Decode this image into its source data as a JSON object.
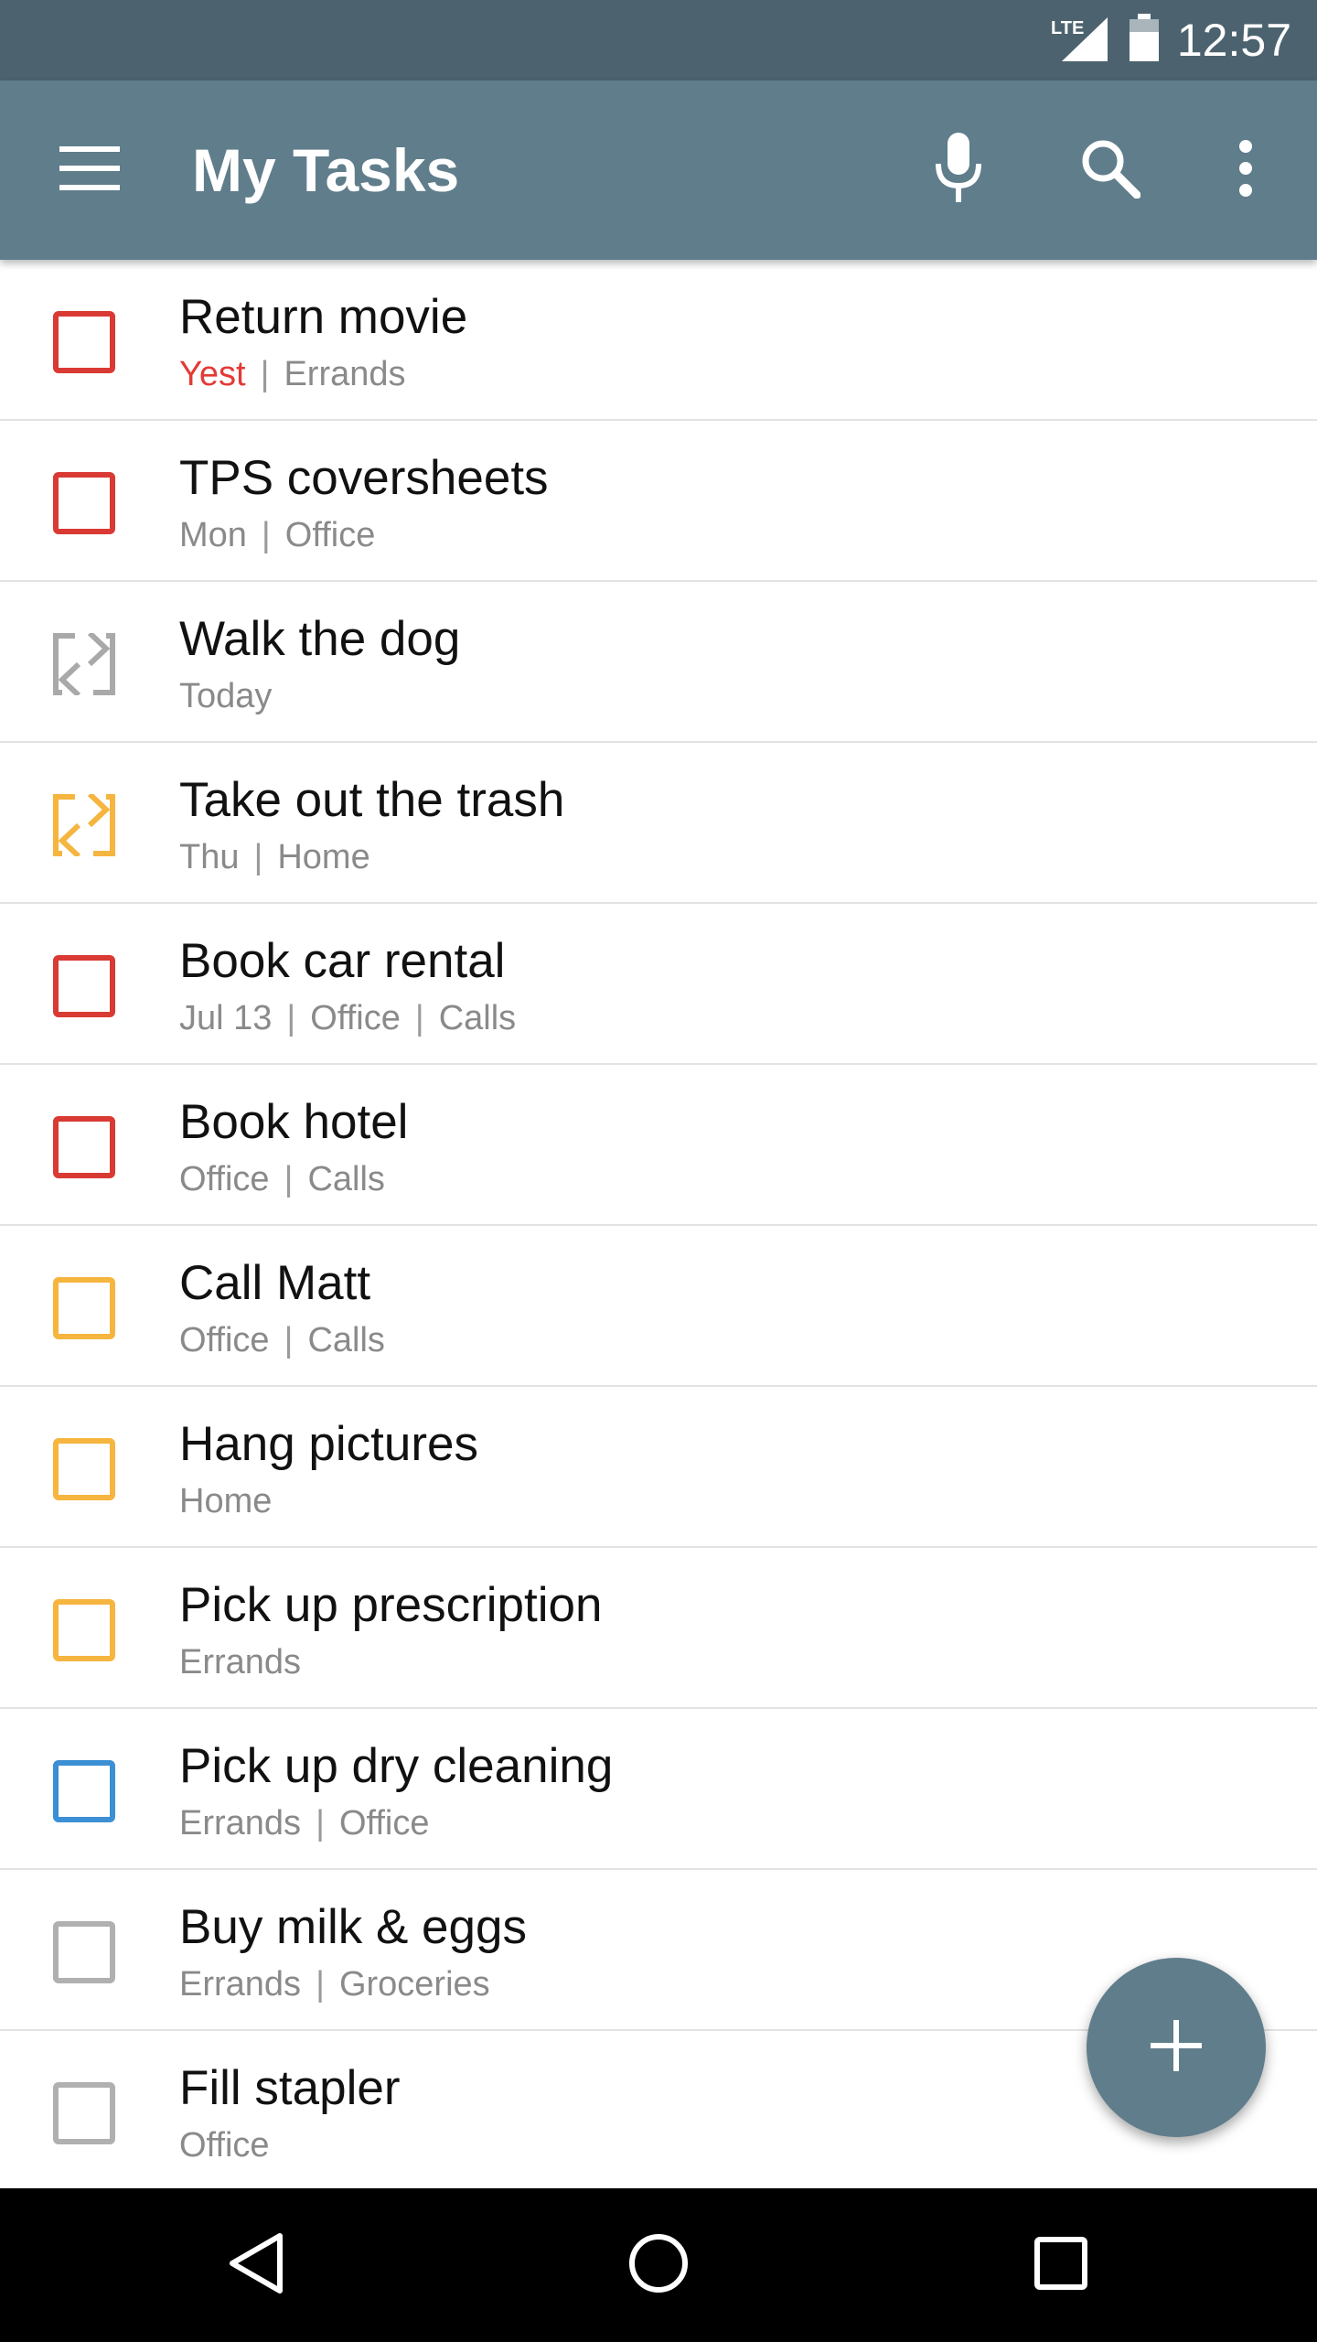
{
  "status_bar": {
    "network_label": "LTE",
    "time": "12:57",
    "icons": [
      "lte-signal-icon",
      "battery-icon"
    ]
  },
  "app_bar": {
    "title": "My Tasks",
    "icons": [
      "menu-icon",
      "microphone-icon",
      "search-icon",
      "more-vert-icon"
    ]
  },
  "colors": {
    "app_bar": "#607d8b",
    "status_bar": "#4c636f",
    "priority_high": "#e53935",
    "priority_medium": "#f5b53f",
    "priority_low": "#3b8fd4",
    "priority_none": "#b0b0b0",
    "overdue_text": "#e53935"
  },
  "tasks": [
    {
      "title": "Return movie",
      "due": "Yest",
      "overdue": true,
      "tags": [
        "Errands"
      ],
      "icon": "checkbox-icon",
      "color": "#d93a34"
    },
    {
      "title": "TPS coversheets",
      "due": "Mon",
      "overdue": false,
      "tags": [
        "Office"
      ],
      "icon": "checkbox-icon",
      "color": "#d93a34"
    },
    {
      "title": "Walk the dog",
      "due": "Today",
      "overdue": false,
      "tags": [],
      "icon": "repeat-checkbox-icon",
      "color": "#a9a9a9"
    },
    {
      "title": "Take out the trash",
      "due": "Thu",
      "overdue": false,
      "tags": [
        "Home"
      ],
      "icon": "repeat-checkbox-icon",
      "color": "#f5b53f"
    },
    {
      "title": "Book car rental",
      "due": "Jul 13",
      "overdue": false,
      "tags": [
        "Office",
        "Calls"
      ],
      "icon": "checkbox-icon",
      "color": "#d93a34"
    },
    {
      "title": "Book hotel",
      "due": "",
      "overdue": false,
      "tags": [
        "Office",
        "Calls"
      ],
      "icon": "checkbox-icon",
      "color": "#d93a34"
    },
    {
      "title": "Call Matt",
      "due": "",
      "overdue": false,
      "tags": [
        "Office",
        "Calls"
      ],
      "icon": "checkbox-icon",
      "color": "#f5b53f"
    },
    {
      "title": "Hang pictures",
      "due": "",
      "overdue": false,
      "tags": [
        "Home"
      ],
      "icon": "checkbox-icon",
      "color": "#f5b53f"
    },
    {
      "title": "Pick up prescription",
      "due": "",
      "overdue": false,
      "tags": [
        "Errands"
      ],
      "icon": "checkbox-icon",
      "color": "#f5b53f"
    },
    {
      "title": "Pick up dry cleaning",
      "due": "",
      "overdue": false,
      "tags": [
        "Errands",
        "Office"
      ],
      "icon": "checkbox-icon",
      "color": "#3b8fd4"
    },
    {
      "title": "Buy milk & eggs",
      "due": "",
      "overdue": false,
      "tags": [
        "Errands",
        "Groceries"
      ],
      "icon": "checkbox-icon",
      "color": "#b0b0b0"
    },
    {
      "title": "Fill stapler",
      "due": "",
      "overdue": false,
      "tags": [
        "Office"
      ],
      "icon": "checkbox-icon",
      "color": "#b0b0b0"
    }
  ],
  "fab": {
    "icon": "add-icon"
  },
  "nav_bar": {
    "icons": [
      "back-icon",
      "home-icon",
      "recents-icon"
    ]
  }
}
